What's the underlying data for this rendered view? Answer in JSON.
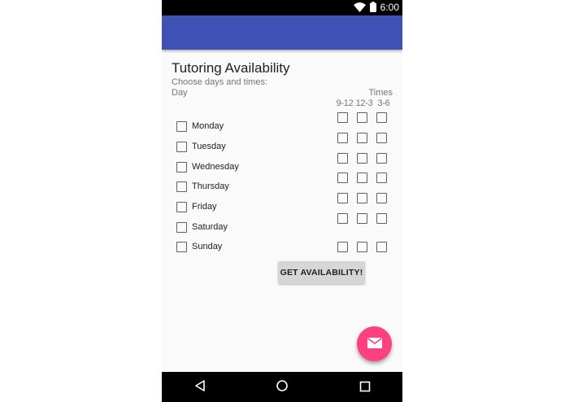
{
  "status_bar": {
    "time": "6:00",
    "icons": [
      "wifi-icon",
      "battery-icon"
    ]
  },
  "app_bar": {
    "color": "#3f51b5"
  },
  "form": {
    "title": "Tutoring Availability",
    "subtitle": "Choose days and times:",
    "day_header": "Day",
    "times_header": "Times",
    "time_columns": [
      "9-12",
      "12-3",
      "3-6"
    ],
    "days": [
      "Monday",
      "Tuesday",
      "Wednesday",
      "Thursday",
      "Friday",
      "Saturday",
      "Sunday"
    ],
    "submit_label": "GET AVAILABILITY!"
  },
  "fab": {
    "icon": "email-icon",
    "color": "#ff4081"
  },
  "nav_bar": {
    "icons": [
      "back-icon",
      "home-icon",
      "recents-icon"
    ]
  }
}
